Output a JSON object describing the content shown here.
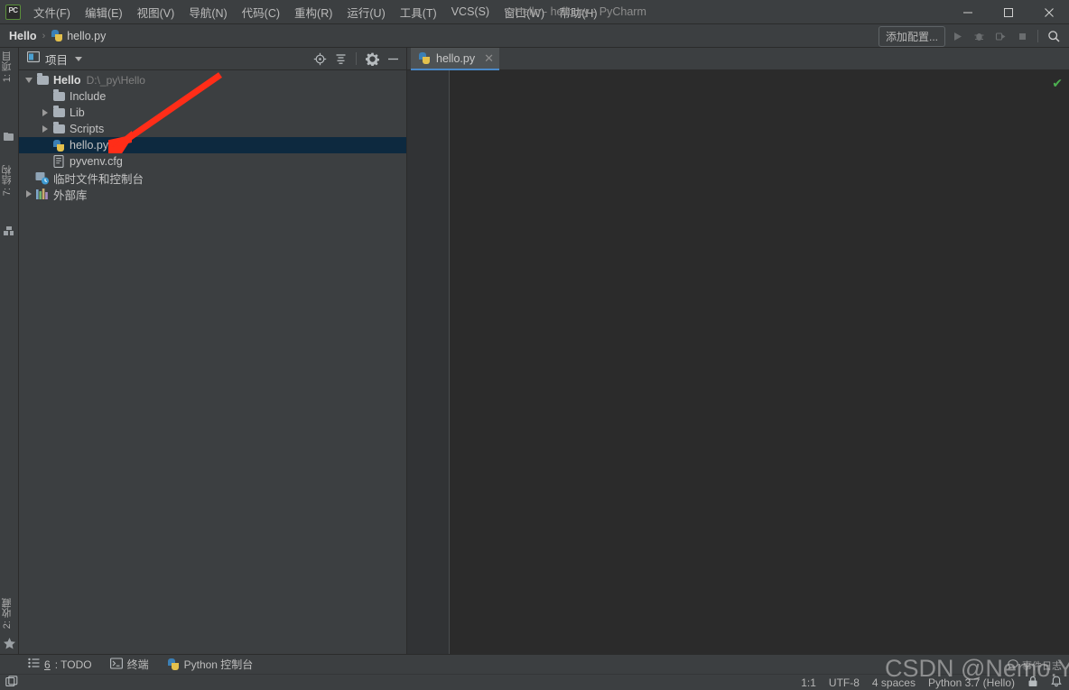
{
  "window": {
    "title": "Hello - hello.py - PyCharm",
    "minimize_label": "—",
    "maximize_label": "☐",
    "close_label": "✕",
    "logo_name": "pycharm-logo"
  },
  "menubar": {
    "items": [
      {
        "label": "文件(F)",
        "name": "menu-file"
      },
      {
        "label": "编辑(E)",
        "name": "menu-edit"
      },
      {
        "label": "视图(V)",
        "name": "menu-view"
      },
      {
        "label": "导航(N)",
        "name": "menu-navigate"
      },
      {
        "label": "代码(C)",
        "name": "menu-code"
      },
      {
        "label": "重构(R)",
        "name": "menu-refactor"
      },
      {
        "label": "运行(U)",
        "name": "menu-run"
      },
      {
        "label": "工具(T)",
        "name": "menu-tools"
      },
      {
        "label": "VCS(S)",
        "name": "menu-vcs"
      },
      {
        "label": "窗口(W)",
        "name": "menu-window"
      },
      {
        "label": "帮助(H)",
        "name": "menu-help"
      }
    ]
  },
  "navbar": {
    "breadcrumbs": [
      {
        "label": "Hello",
        "name": "breadcrumb-project"
      },
      {
        "label": "hello.py",
        "name": "breadcrumb-file"
      }
    ],
    "separator": "›",
    "add_config_label": "添加配置...",
    "run_icon": "run-icon",
    "debug_icon": "debug-icon",
    "coverage_icon": "coverage-icon",
    "stop_icon": "stop-icon",
    "search_icon": "search-icon"
  },
  "left_strip": {
    "top_tab": "1: 项目",
    "mid_tab": "7: 结构",
    "bottom_tab": "2: 收藏"
  },
  "project_panel": {
    "title": "项目",
    "panel_icon": "project-window-icon",
    "actions": [
      {
        "name": "locate-file-icon",
        "label": "⊕"
      },
      {
        "name": "collapse-all-icon",
        "label": "☰"
      },
      {
        "name": "settings-gear-icon",
        "label": "⚙"
      },
      {
        "name": "hide-panel-icon",
        "label": "—"
      }
    ],
    "tree": [
      {
        "name": "tree-node-hello",
        "label": "Hello",
        "path": "D:\\_py\\Hello",
        "indent": 0,
        "expander": "down",
        "icon": "folder-icon",
        "bold": true,
        "selected": false
      },
      {
        "name": "tree-node-include",
        "label": "Include",
        "path": "",
        "indent": 1,
        "expander": "none",
        "icon": "folder-icon",
        "bold": false,
        "selected": false
      },
      {
        "name": "tree-node-lib",
        "label": "Lib",
        "path": "",
        "indent": 1,
        "expander": "right",
        "icon": "folder-icon",
        "bold": false,
        "selected": false
      },
      {
        "name": "tree-node-scripts",
        "label": "Scripts",
        "path": "",
        "indent": 1,
        "expander": "right",
        "icon": "folder-icon",
        "bold": false,
        "selected": false
      },
      {
        "name": "tree-node-hello-py",
        "label": "hello.py",
        "path": "",
        "indent": 1,
        "expander": "none",
        "icon": "python-file-icon",
        "bold": false,
        "selected": true
      },
      {
        "name": "tree-node-pyvenv-cfg",
        "label": "pyvenv.cfg",
        "path": "",
        "indent": 1,
        "expander": "none",
        "icon": "config-file-icon",
        "bold": false,
        "selected": false
      },
      {
        "name": "tree-node-scratches",
        "label": "临时文件和控制台",
        "path": "",
        "indent": 0,
        "expander": "none",
        "icon": "scratches-icon",
        "bold": false,
        "selected": false
      },
      {
        "name": "tree-node-external-libs",
        "label": "外部库",
        "path": "",
        "indent": 0,
        "expander": "right",
        "icon": "external-libraries-icon",
        "bold": false,
        "selected": false
      }
    ]
  },
  "editor": {
    "tab_label": "hello.py",
    "tab_icon": "python-file-icon",
    "tab_close": "✕",
    "content": "",
    "inspection_status": "✔"
  },
  "bottom_bar": {
    "items": [
      {
        "name": "tool-window-todo",
        "prefix": "6",
        "label": ": TODO",
        "icon": "todo-icon"
      },
      {
        "name": "tool-window-terminal",
        "prefix": "",
        "label": "终端",
        "icon": "terminal-icon"
      },
      {
        "name": "tool-window-python-console",
        "prefix": "",
        "label": "Python 控制台",
        "icon": "python-icon"
      }
    ]
  },
  "status_bar": {
    "toggle_icon": "toggle-toolwindows-icon",
    "caret_position": "1:1",
    "encoding": "UTF-8",
    "indent": "4 spaces",
    "interpreter": "Python 3.7 (Hello)",
    "lock_icon": "lock-icon",
    "notifications_icon": "notifications-icon"
  },
  "overlays": {
    "watermark": "CSDN @Nemo.Yxc",
    "event_log": "事件日志",
    "event_log_icon": "balloon-icon",
    "annotation_arrow": "red-arrow-annotation"
  },
  "colors": {
    "chrome": "#3c3f41",
    "editor_bg": "#2b2b2b",
    "gutter_bg": "#313335",
    "selection": "#0d293f",
    "tab_active": "#4e5254",
    "tab_underline": "#4a88c7",
    "annotation_red": "#ff2d18",
    "ok_green": "#4caf50"
  }
}
